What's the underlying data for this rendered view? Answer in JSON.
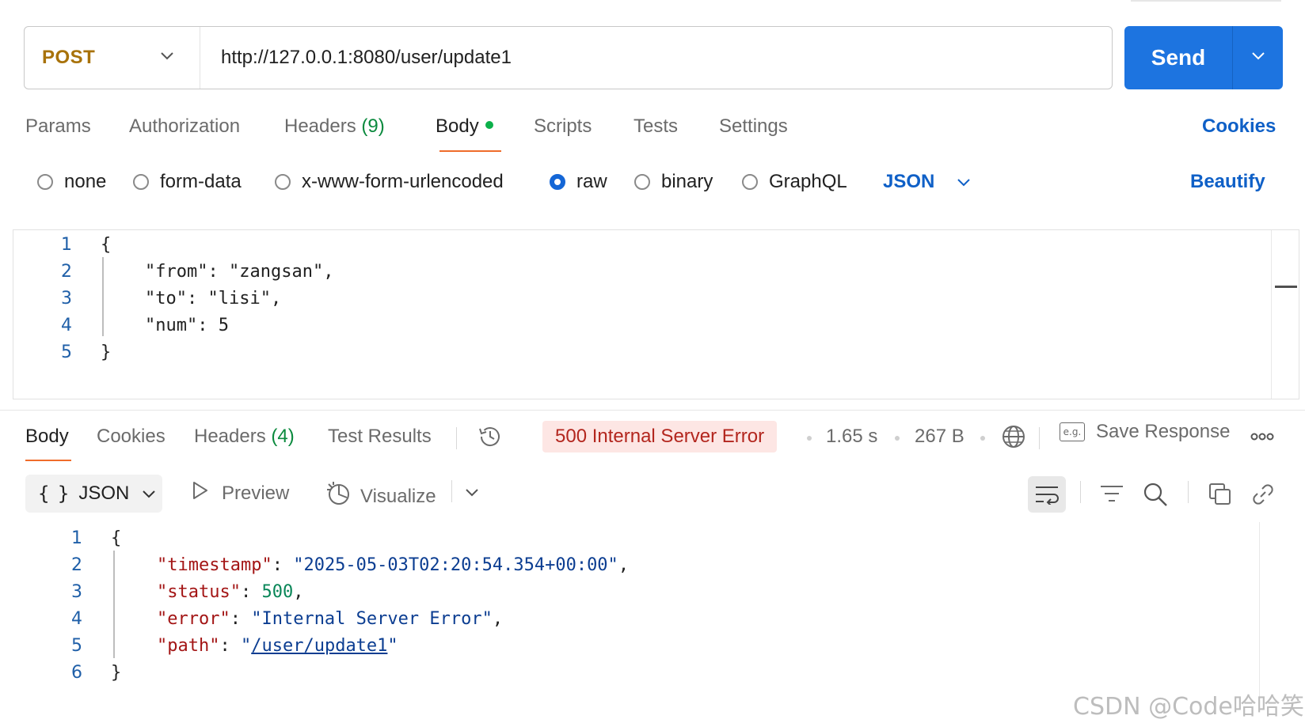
{
  "request": {
    "method": "POST",
    "url": "http://127.0.0.1:8080/user/update1",
    "send_label": "Send"
  },
  "request_tabs": [
    {
      "label": "Params"
    },
    {
      "label": "Authorization"
    },
    {
      "label": "Headers",
      "count": "(9)"
    },
    {
      "label": "Body",
      "active": true
    },
    {
      "label": "Scripts"
    },
    {
      "label": "Tests"
    },
    {
      "label": "Settings"
    }
  ],
  "cookies_label": "Cookies",
  "body_types": [
    {
      "label": "none"
    },
    {
      "label": "form-data"
    },
    {
      "label": "x-www-form-urlencoded"
    },
    {
      "label": "raw",
      "selected": true
    },
    {
      "label": "binary"
    },
    {
      "label": "GraphQL"
    }
  ],
  "body_format": "JSON",
  "beautify_label": "Beautify",
  "request_body": {
    "line_numbers": [
      "1",
      "2",
      "3",
      "4",
      "5"
    ],
    "open_brace": "{",
    "close_brace": "}",
    "fields": [
      {
        "key": "\"from\"",
        "value": "\"zangsan\"",
        "trail": ","
      },
      {
        "key": "\"to\"",
        "value": "\"lisi\"",
        "trail": ","
      },
      {
        "key": "\"num\"",
        "value": "5",
        "trail": ""
      }
    ]
  },
  "response_tabs": [
    {
      "label": "Body",
      "active": true
    },
    {
      "label": "Cookies"
    },
    {
      "label": "Headers",
      "count": "(4)"
    },
    {
      "label": "Test Results"
    }
  ],
  "response_meta": {
    "status": "500 Internal Server Error",
    "time": "1.65 s",
    "size": "267 B",
    "save_label": "Save Response",
    "save_icon_text": "e.g."
  },
  "response_toolbar": {
    "format_label": "JSON",
    "format_icon_text": "{ }",
    "preview_label": "Preview",
    "visualize_label": "Visualize"
  },
  "response_body": {
    "line_numbers": [
      "1",
      "2",
      "3",
      "4",
      "5",
      "6"
    ],
    "open_brace": "{",
    "close_brace": "}",
    "fields": [
      {
        "key": "\"timestamp\"",
        "value": "\"2025-05-03T02:20:54.354+00:00\"",
        "trail": ",",
        "type": "string"
      },
      {
        "key": "\"status\"",
        "value": "500",
        "trail": ",",
        "type": "number"
      },
      {
        "key": "\"error\"",
        "value": "\"Internal Server Error\"",
        "trail": ",",
        "type": "string"
      },
      {
        "key": "\"path\"",
        "value_quote": "\"",
        "value_link": "/user/update1",
        "trail": "",
        "type": "link"
      }
    ]
  },
  "watermark": "CSDN @Code哈哈笑",
  "colors": {
    "method": "#a8720a",
    "send": "#1d74e0",
    "accent_link": "#0f60c7",
    "tab_underline": "#ef6c2b",
    "status_error_bg": "#fde6e4",
    "status_error_text": "#b3261e",
    "json_key": "#a31515",
    "json_string": "#0b3d91",
    "json_number": "#098658"
  },
  "icons": [
    "chevron-down-icon",
    "history-icon",
    "globe-icon",
    "play-icon",
    "visualize-icon",
    "wrap-icon",
    "filter-icon",
    "search-icon",
    "copy-icon",
    "link-icon",
    "more-icon"
  ]
}
